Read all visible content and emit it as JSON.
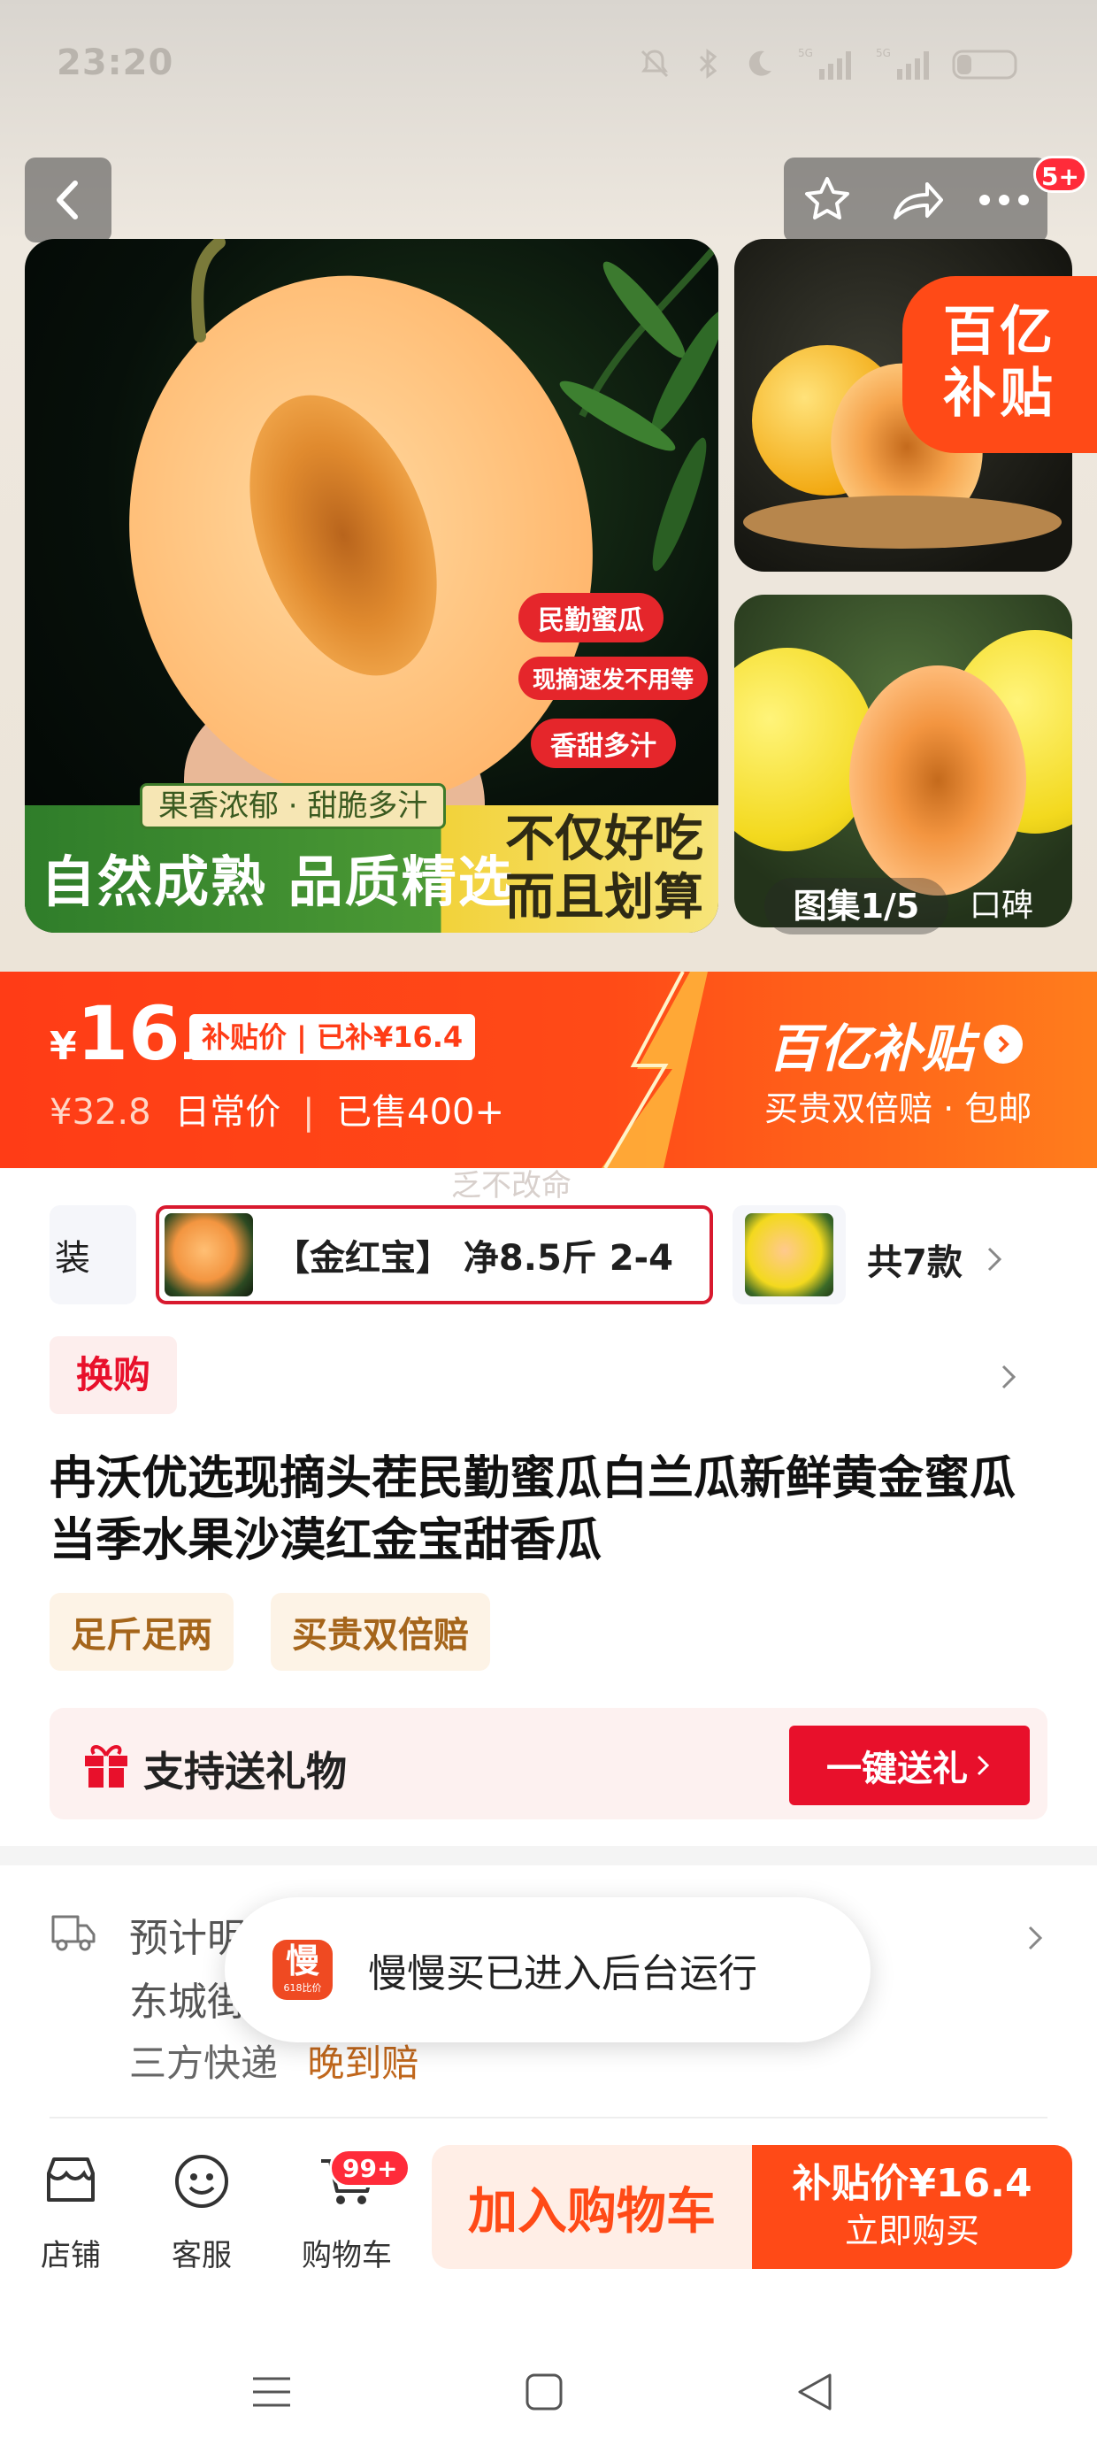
{
  "status_bar": {
    "time": "23:20",
    "signal_1": "5G",
    "signal_2": "5G"
  },
  "header": {
    "cart_badge": "5+"
  },
  "gallery": {
    "main_tags": [
      "民勤蜜瓜",
      "现摘速发不用等",
      "香甜多汁"
    ],
    "main_slogan_small": "果香浓郁 · 甜脆多汁",
    "main_slogan_big": "自然成熟 品质精选",
    "main_slogan_right": [
      "不仅好吃",
      "而且划算"
    ],
    "subsidy_badge": [
      "百亿",
      "补贴"
    ],
    "counter": "图集1/5",
    "reviews_label": "口碑"
  },
  "price_bar": {
    "currency": "¥",
    "price_int": "16",
    "price_dec": ".4",
    "subsidy_tag": "补贴价 | 已补¥16.4",
    "original_price": "¥32.8",
    "original_label": "日常价",
    "sold": "已售400+",
    "brand": "百亿补贴",
    "promise": "买贵双倍赔 · 包邮"
  },
  "watermark": "乏不改命",
  "variants": {
    "left_partial": "装",
    "selected": "【金红宝】 净8.5斤 2-4",
    "total": "共7款"
  },
  "exchange_tag": "换购",
  "product_title": "冉沃优选现摘头茬民勤蜜瓜白兰瓜新鲜黄金蜜瓜当季水果沙漠红金宝甜香瓜",
  "promise_pills": [
    "足斤足两",
    "买贵双倍赔"
  ],
  "gift": {
    "label": "支持送礼物",
    "button": "一键送礼"
  },
  "shipping": {
    "line1": "预计明",
    "line2": "东城街",
    "line3_prefix": "三方快递",
    "line3_highlight": "晚到赔"
  },
  "toast": {
    "app_icon_text": "慢",
    "app_icon_sub": "618比价",
    "message": "慢慢买已进入后台运行"
  },
  "bottom_bar": {
    "shop": "店铺",
    "service": "客服",
    "cart": "购物车",
    "cart_badge": "99+",
    "add_to_cart": "加入购物车",
    "buy_price": "补贴价¥16.4",
    "buy_now": "立即购买"
  },
  "colors": {
    "brand_red": "#ff4316",
    "deep_red": "#e8102b",
    "gold": "#a5651b",
    "orange": "#ff7a1c"
  }
}
